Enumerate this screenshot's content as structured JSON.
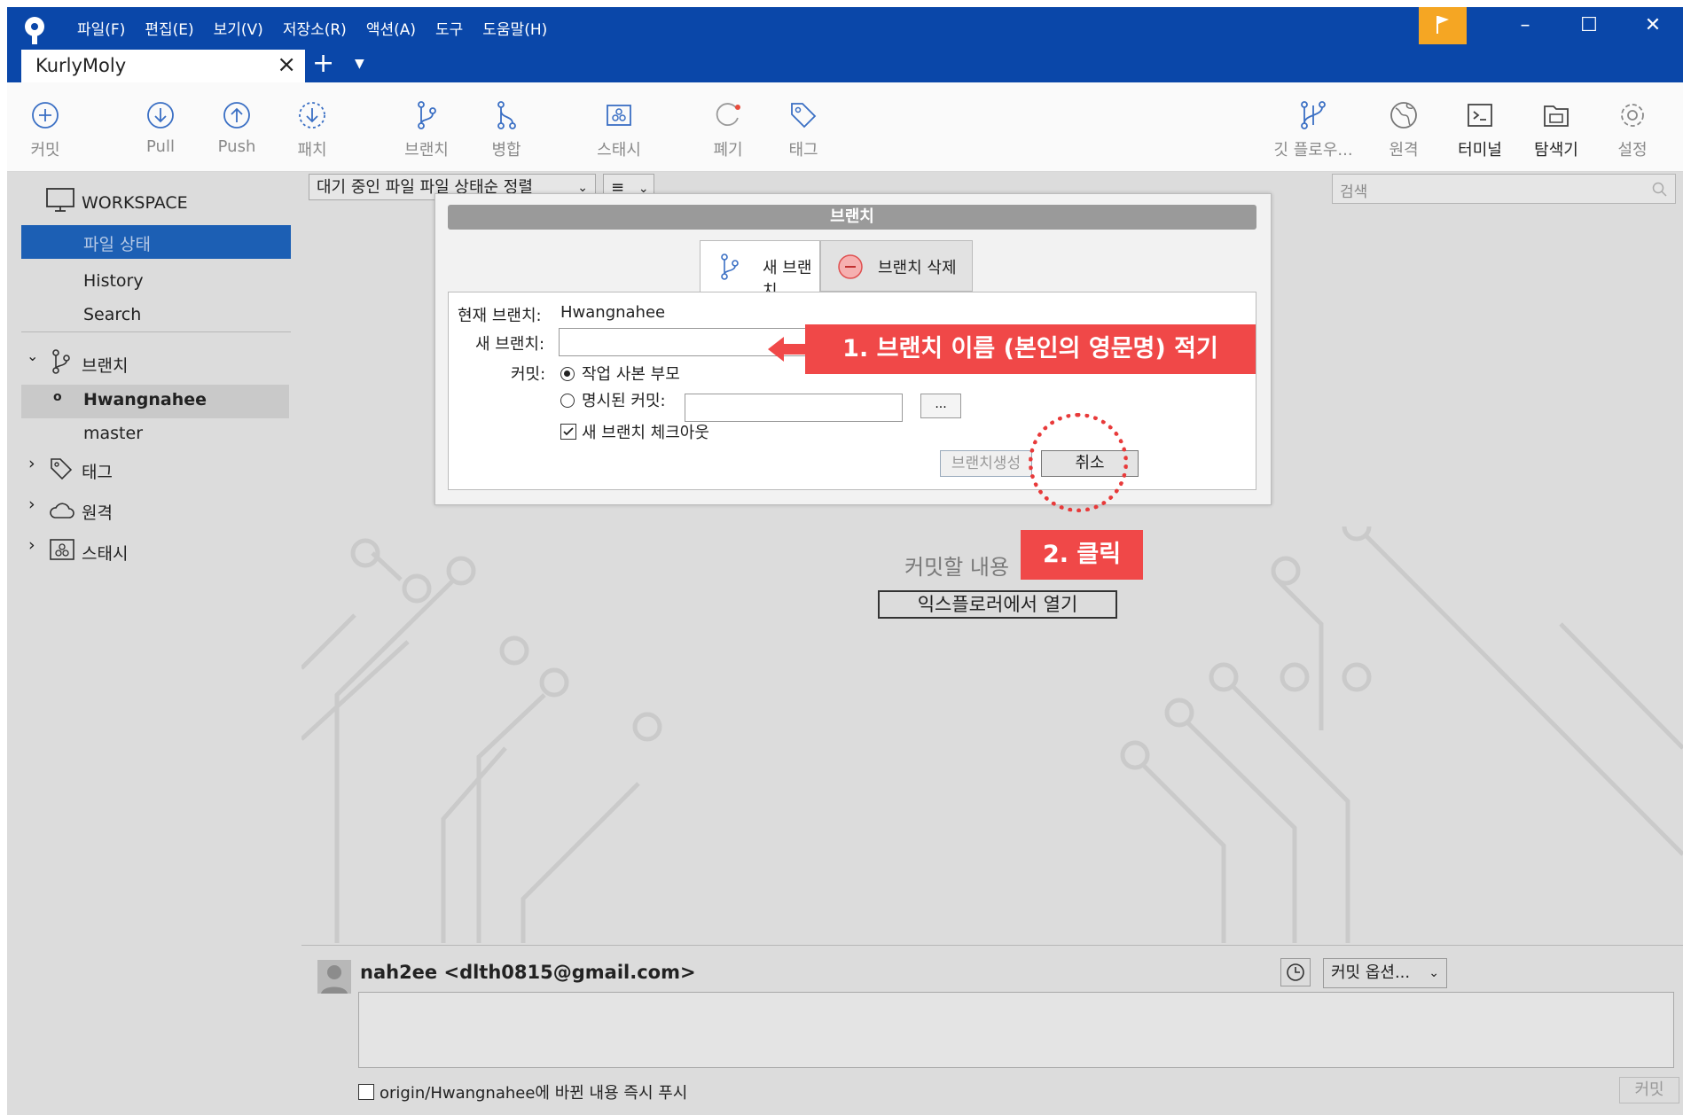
{
  "menu": [
    "파일(F)",
    "편집(E)",
    "보기(V)",
    "저장소(R)",
    "액션(A)",
    "도구",
    "도움말(H)"
  ],
  "tab": {
    "title": "KurlyMoly"
  },
  "toolbar": {
    "commit": "커밋",
    "pull": "Pull",
    "push": "Push",
    "patch": "패치",
    "branch": "브랜치",
    "merge": "병합",
    "stash": "스태시",
    "discard": "폐기",
    "tag": "태그",
    "gitflow": "깃 플로우...",
    "remote": "원격",
    "terminal": "터미널",
    "explorer": "탐색기",
    "settings": "설정"
  },
  "sidebar": {
    "workspace": "WORKSPACE",
    "file_status": "파일 상태",
    "history": "History",
    "search": "Search",
    "branches": "브랜치",
    "current_branch": "Hwangnahee",
    "master": "master",
    "tags": "태그",
    "remotes": "원격",
    "stashes": "스태시"
  },
  "main": {
    "filter_staged": "대기 중인 파일",
    "filter_sort": "파일 상태순 정렬",
    "search_placeholder": "검색",
    "empty_message": "커밋할 내용",
    "open_explorer": "익스플로러에서 열기"
  },
  "commit_panel": {
    "author": "nah2ee <dlth0815@gmail.com>",
    "options": "커밋 옵션...",
    "push_label": "origin/Hwangnahee에 바뀐 내용 즉시 푸시",
    "commit_button": "커밋"
  },
  "dialog": {
    "title": "브랜치",
    "tab_new": "새 브랜치",
    "tab_delete": "브랜치 삭제",
    "current_branch_label": "현재 브랜치:",
    "current_branch_value": "Hwangnahee",
    "new_branch_label": "새 브랜치:",
    "new_branch_value": "",
    "commit_label": "커밋:",
    "option_working_parent": "작업 사본 부모",
    "option_specified": "명시된 커밋:",
    "dots": "...",
    "checkout_label": "새 브랜치 체크아웃",
    "create_button": "브랜치생성",
    "cancel_button": "취소"
  },
  "annotations": {
    "step1": "1. 브랜치 이름 (본인의 영문명) 적기",
    "step2": "2. 클릭"
  },
  "colors": {
    "titlebar": "#0a47a9",
    "accent": "#f04848",
    "flag": "#f5a623",
    "selected": "#1c5fb4"
  }
}
